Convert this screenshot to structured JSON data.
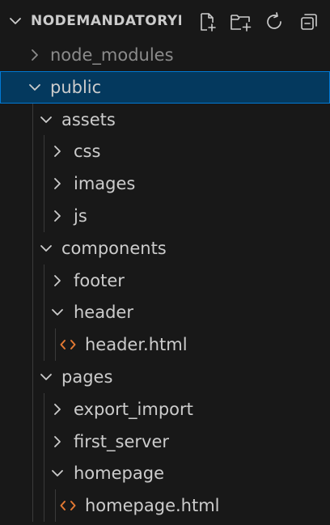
{
  "explorer": {
    "title": "NODEMANDATORYI",
    "actions": [
      {
        "name": "new-file-icon"
      },
      {
        "name": "new-folder-icon"
      },
      {
        "name": "refresh-icon"
      },
      {
        "name": "collapse-all-icon"
      }
    ]
  },
  "tree": {
    "items": [
      {
        "label": "node_modules",
        "type": "folder",
        "expanded": false,
        "depth": 0,
        "dim": true
      },
      {
        "label": "public",
        "type": "folder",
        "expanded": true,
        "depth": 0,
        "selected": true
      },
      {
        "label": "assets",
        "type": "folder",
        "expanded": true,
        "depth": 1
      },
      {
        "label": "css",
        "type": "folder",
        "expanded": false,
        "depth": 2
      },
      {
        "label": "images",
        "type": "folder",
        "expanded": false,
        "depth": 2
      },
      {
        "label": "js",
        "type": "folder",
        "expanded": false,
        "depth": 2
      },
      {
        "label": "components",
        "type": "folder",
        "expanded": true,
        "depth": 1
      },
      {
        "label": "footer",
        "type": "folder",
        "expanded": false,
        "depth": 2
      },
      {
        "label": "header",
        "type": "folder",
        "expanded": true,
        "depth": 2
      },
      {
        "label": "header.html",
        "type": "html-file",
        "depth": 3
      },
      {
        "label": "pages",
        "type": "folder",
        "expanded": true,
        "depth": 1
      },
      {
        "label": "export_import",
        "type": "folder",
        "expanded": false,
        "depth": 2
      },
      {
        "label": "first_server",
        "type": "folder",
        "expanded": false,
        "depth": 2
      },
      {
        "label": "homepage",
        "type": "folder",
        "expanded": true,
        "depth": 2
      },
      {
        "label": "homepage.html",
        "type": "html-file",
        "depth": 3
      }
    ]
  },
  "colors": {
    "background": "#181818",
    "selected_bg": "#04395e",
    "selected_border": "#0078d4",
    "text": "#cccccc",
    "dim_text": "#8b8b8b",
    "html_icon": "#e37933",
    "guide": "#3a3a3a"
  }
}
